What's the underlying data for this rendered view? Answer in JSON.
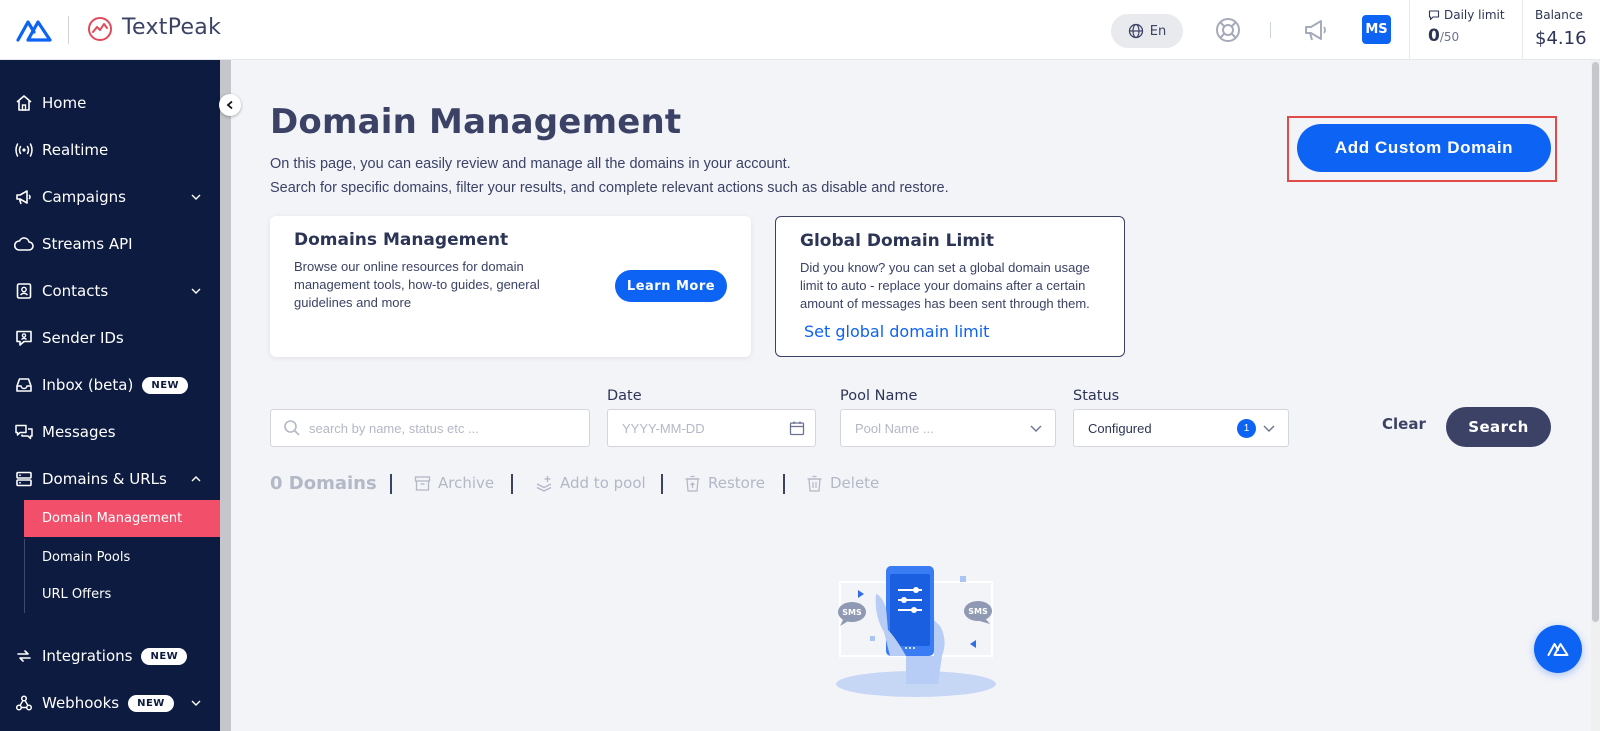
{
  "header": {
    "brand": "TextPeak",
    "language": "En",
    "avatar_initials": "MS",
    "daily_limit_label": "Daily limit",
    "daily_limit_used": "0",
    "daily_limit_total": "/50",
    "balance_label": "Balance",
    "balance_value": "$4.16"
  },
  "sidebar": {
    "items": [
      {
        "label": "Home",
        "icon": "home-icon"
      },
      {
        "label": "Realtime",
        "icon": "broadcast-icon"
      },
      {
        "label": "Campaigns",
        "icon": "megaphone-icon"
      },
      {
        "label": "Streams API",
        "icon": "cloud-icon"
      },
      {
        "label": "Contacts",
        "icon": "contacts-icon"
      },
      {
        "label": "Sender IDs",
        "icon": "sender-icon"
      },
      {
        "label": "Inbox (beta)",
        "icon": "inbox-icon",
        "badge": "NEW"
      },
      {
        "label": "Messages",
        "icon": "messages-icon"
      },
      {
        "label": "Domains & URLs",
        "icon": "domains-icon"
      },
      {
        "label": "Integrations",
        "icon": "integrations-icon",
        "badge": "NEW"
      },
      {
        "label": "Webhooks",
        "icon": "webhooks-icon",
        "badge": "NEW"
      }
    ],
    "subitems": [
      {
        "label": "Domain Management",
        "active": true
      },
      {
        "label": "Domain Pools",
        "active": false
      },
      {
        "label": "URL Offers",
        "active": false
      }
    ]
  },
  "main": {
    "title": "Domain Management",
    "desc_line1": "On this page, you can easily review and manage all the domains in your account.",
    "desc_line2": "Search for specific domains, filter your results, and complete relevant actions such as disable and restore.",
    "add_button": "Add Custom Domain",
    "card1": {
      "title": "Domains Management",
      "text_line1": "Browse our online resources for domain",
      "text_line2": "management tools, how-to guides, general",
      "text_line3": "guidelines and more",
      "button": "Learn More"
    },
    "card2": {
      "title": "Global Domain Limit",
      "text_line1": "Did you know? you can set a global domain usage",
      "text_line2": "limit to auto - replace your domains after a certain",
      "text_line3": "amount of messages has been sent through them.",
      "link": "Set global domain limit"
    },
    "filters": {
      "search_placeholder": "search by name, status etc ...",
      "date_label": "Date",
      "date_placeholder": "YYYY-MM-DD",
      "pool_label": "Pool Name",
      "pool_placeholder": "Pool Name ...",
      "status_label": "Status",
      "status_value": "Configured",
      "status_count": "1",
      "clear": "Clear",
      "search": "Search"
    },
    "actions": {
      "count": "0 Domains",
      "archive": "Archive",
      "add_to_pool": "Add to pool",
      "restore": "Restore",
      "delete": "Delete"
    },
    "illustration": {
      "bubble_text": "SMS"
    }
  },
  "colors": {
    "primary": "#0d63f3",
    "sidebar_bg": "#0c1b3f",
    "active_item": "#f24f6b",
    "text_dark": "#3b4266"
  }
}
